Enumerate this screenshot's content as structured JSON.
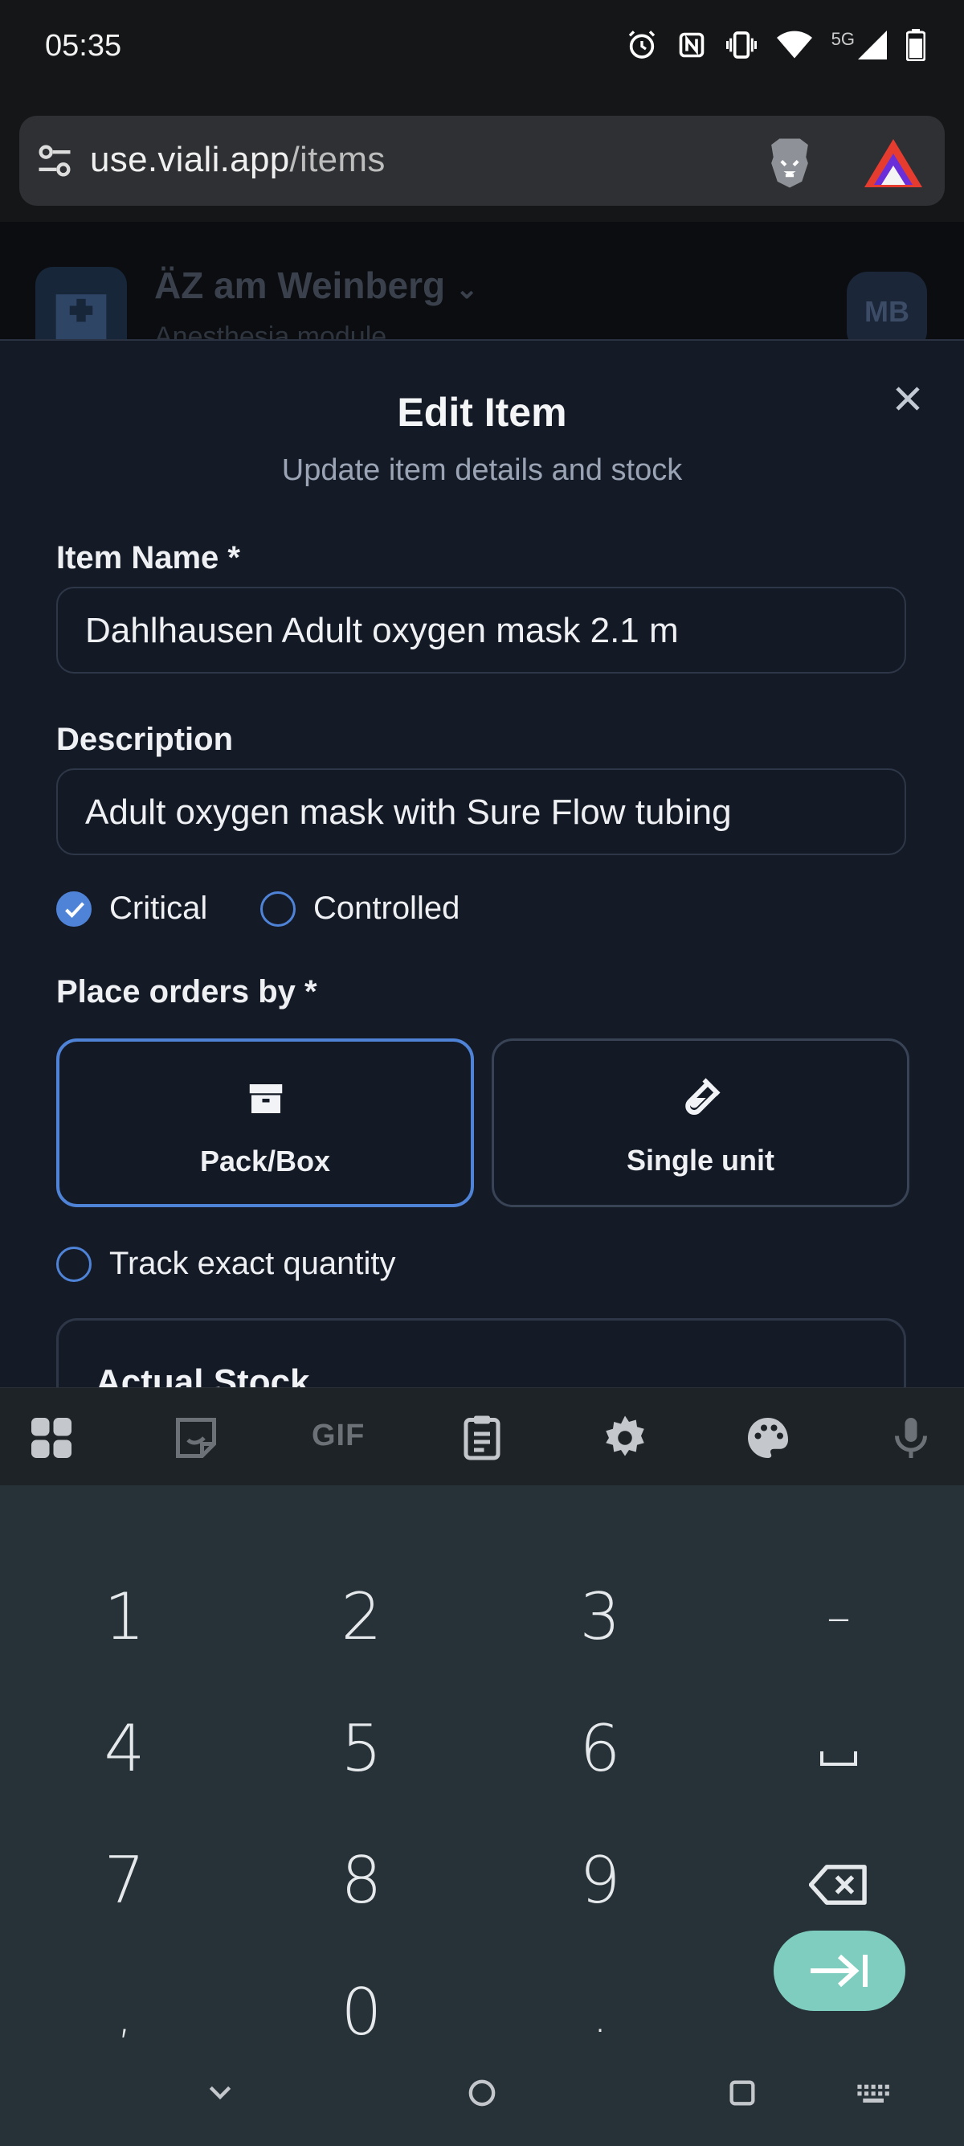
{
  "status_bar": {
    "time": "05:35",
    "icons": [
      "alarm-icon",
      "nfc-icon",
      "vibrate-icon",
      "wifi-icon",
      "5g-icon",
      "signal-icon",
      "battery-icon"
    ],
    "network": "5G"
  },
  "browser": {
    "url_domain": "use.viali.app",
    "url_path": "/items",
    "icons": [
      "site-settings-icon",
      "brave-shields-icon",
      "brave-rewards-icon"
    ]
  },
  "background_page": {
    "org_name": "ÄZ am Weinberg",
    "subtitle": "Anesthesia module",
    "avatar_initials": "MB"
  },
  "dialog": {
    "title": "Edit Item",
    "subtitle": "Update item details and stock",
    "item_name_label": "Item Name *",
    "item_name_value": "Dahlhausen Adult oxygen mask 2.1 m",
    "description_label": "Description",
    "description_value": "Adult oxygen mask with Sure Flow tubing",
    "critical_label": "Critical",
    "critical_checked": true,
    "controlled_label": "Controlled",
    "controlled_checked": false,
    "order_by_label": "Place orders by *",
    "order_options": [
      {
        "label": "Pack/Box",
        "icon": "box-icon",
        "selected": true
      },
      {
        "label": "Single unit",
        "icon": "test-tube-icon",
        "selected": false
      }
    ],
    "track_exact_label": "Track exact quantity",
    "track_exact_checked": false,
    "stock_section_title": "Actual Stock"
  },
  "keyboard": {
    "toolbar": [
      "apps-icon",
      "sticker-icon",
      "GIF",
      "clipboard-icon",
      "settings-icon",
      "palette-icon",
      "mic-icon"
    ],
    "gif_label": "GIF",
    "keys": [
      [
        "1",
        "2",
        "3",
        "–"
      ],
      [
        "4",
        "5",
        "6",
        "␣"
      ],
      [
        "7",
        "8",
        "9",
        "backspace-icon"
      ],
      [
        ",",
        "0",
        ".",
        "tab-enter-icon"
      ]
    ]
  },
  "colors": {
    "accent": "#4e83d8",
    "dialog_bg": "#151b26",
    "keyboard_bg": "#263238",
    "enter_key": "#7ecdbe"
  }
}
